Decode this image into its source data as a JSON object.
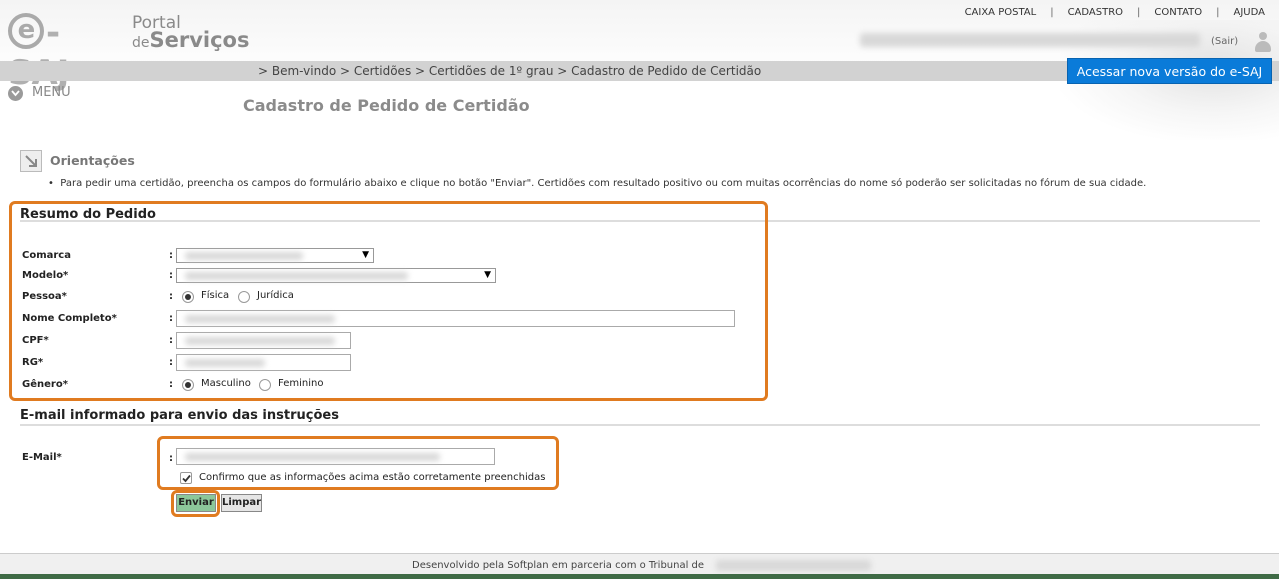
{
  "header": {
    "logo": {
      "e_saj": "e-SAJ",
      "portal": "Portal",
      "de": "de",
      "servicos": "Serviços"
    },
    "top_links": [
      "CAIXA POSTAL",
      "CADASTRO",
      "CONTATO",
      "AJUDA"
    ],
    "sair": "(Sair)",
    "breadcrumb": "> Bem-vindo > Certidões > Certidões de 1º grau > Cadastro de Pedido de Certidão",
    "new_version_button": "Acessar nova versão do e-SAJ",
    "menu_label": "MENU",
    "page_title": "Cadastro de Pedido de Certidão"
  },
  "orientacoes": {
    "title": "Orientações",
    "text": "Para pedir uma certidão, preencha os campos do formulário abaixo e clique no botão \"Enviar\". Certidões com resultado positivo ou com muitas ocorrências do nome só poderão ser solicitadas no fórum de sua cidade."
  },
  "resumo": {
    "title": "Resumo do Pedido",
    "fields": {
      "comarca": "Comarca",
      "modelo": "Modelo*",
      "pessoa": "Pessoa*",
      "nome": "Nome Completo*",
      "cpf": "CPF*",
      "rg": "RG*",
      "genero": "Gênero*"
    },
    "colon": ":",
    "pessoa_options": [
      "Física",
      "Jurídica"
    ],
    "pessoa_selected": "Física",
    "genero_options": [
      "Masculino",
      "Feminino"
    ],
    "genero_selected": "Masculino"
  },
  "email_section": {
    "title": "E-mail informado para envio das instruções",
    "email_label": "E-Mail*",
    "confirm_label": "Confirmo que as informações acima estão corretamente preenchidas",
    "confirm_checked": true
  },
  "buttons": {
    "enviar": "Enviar",
    "limpar": "Limpar"
  },
  "footer": {
    "text": "Desenvolvido pela Softplan em parceria com o Tribunal de"
  },
  "colors": {
    "accent_blue": "#0a7bd9",
    "highlight_orange": "#e07b20",
    "footer_green": "#3f6b46",
    "enviar_green": "#8cc79a"
  }
}
